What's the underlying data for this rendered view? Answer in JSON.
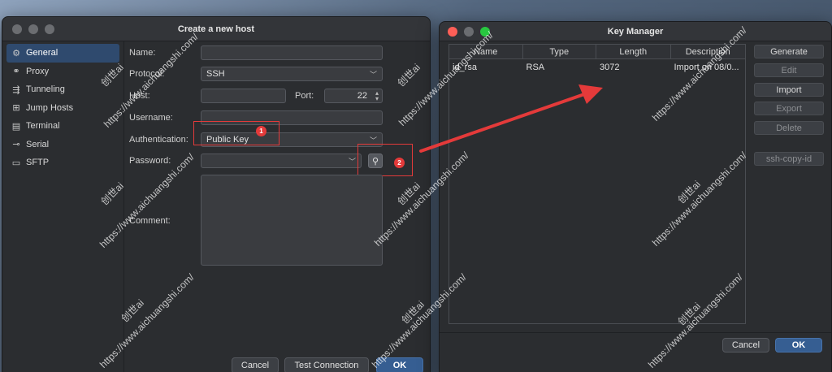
{
  "host_window": {
    "title": "Create a new host",
    "sidebar": [
      {
        "label": "General",
        "icon": "gear-icon",
        "glyph": "⚙"
      },
      {
        "label": "Proxy",
        "icon": "proxy-icon",
        "glyph": "⚭"
      },
      {
        "label": "Tunneling",
        "icon": "tunnel-icon",
        "glyph": "⇶"
      },
      {
        "label": "Jump Hosts",
        "icon": "jump-hosts-icon",
        "glyph": "⊞"
      },
      {
        "label": "Terminal",
        "icon": "terminal-icon",
        "glyph": "▤"
      },
      {
        "label": "Serial",
        "icon": "serial-icon",
        "glyph": "⊸"
      },
      {
        "label": "SFTP",
        "icon": "folder-icon",
        "glyph": "▭"
      }
    ],
    "labels": {
      "name": "Name:",
      "protocol": "Protocol:",
      "host": "Host:",
      "port": "Port:",
      "username": "Username:",
      "authentication": "Authentication:",
      "password": "Password:",
      "comment": "Comment:"
    },
    "values": {
      "name": "",
      "protocol": "SSH",
      "host": "",
      "port": "22",
      "username": "",
      "authentication": "Public Key",
      "password": ""
    },
    "buttons": {
      "cancel": "Cancel",
      "test": "Test Connection",
      "ok": "OK"
    },
    "annotations": {
      "badge1": "1",
      "badge2": "2"
    }
  },
  "key_window": {
    "title": "Key Manager",
    "columns": [
      "Name",
      "Type",
      "Length",
      "Description"
    ],
    "rows": [
      {
        "name": "id_rsa",
        "type": "RSA",
        "length": "3072",
        "description": "Import on 08/0..."
      }
    ],
    "buttons": {
      "generate": "Generate",
      "edit": "Edit",
      "import": "Import",
      "export": "Export",
      "delete": "Delete",
      "ssh_copy_id": "ssh-copy-id",
      "cancel": "Cancel",
      "ok": "OK"
    }
  },
  "watermark": {
    "brand": "创世ai",
    "url": "https://www.aichuangshi.com/"
  },
  "colors": {
    "accent": "#365e92",
    "annotation": "#e43a3a",
    "close": "#fe5f57",
    "minimize": "#febc2e",
    "zoom": "#28c840"
  }
}
